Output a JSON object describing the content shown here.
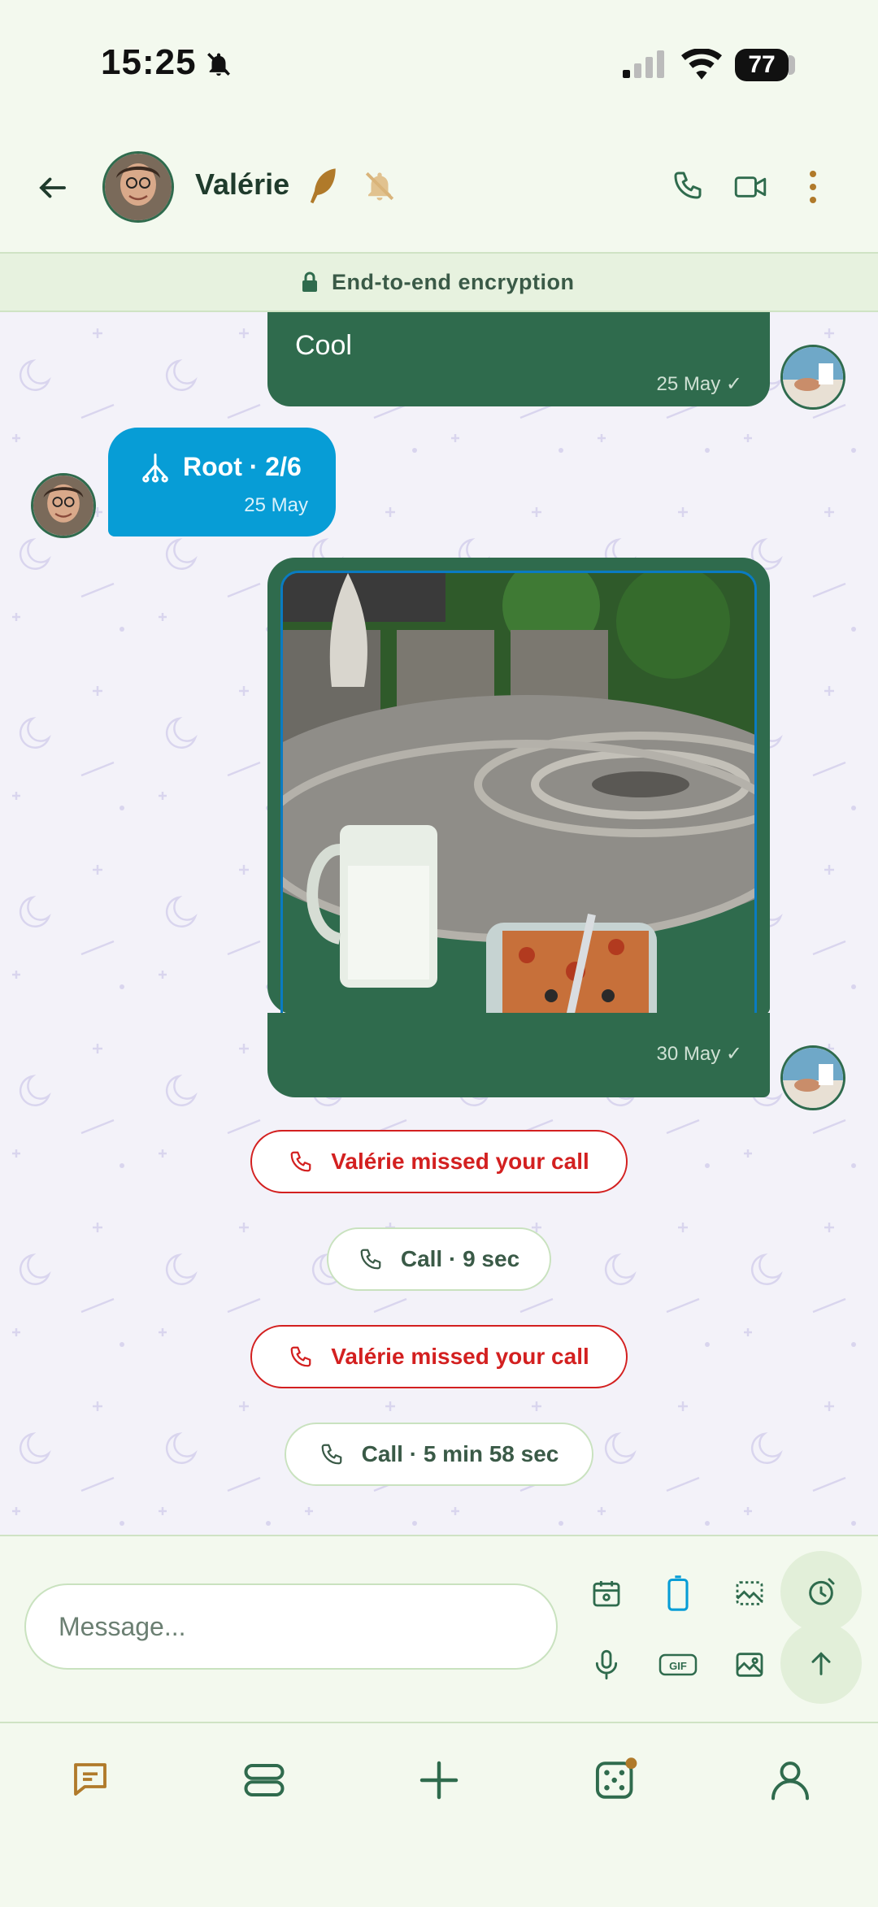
{
  "status_bar": {
    "time": "15:25",
    "battery": "77"
  },
  "header": {
    "contact_name": "Valérie"
  },
  "banner": {
    "text": "End-to-end encryption"
  },
  "messages": {
    "m1": {
      "text": "Cool",
      "time": "25 May ✓"
    },
    "m2": {
      "text": "Root · 2/6",
      "time": "25 May"
    },
    "m3": {
      "time": "30 May ✓"
    }
  },
  "calls": [
    {
      "label": "Valérie missed your call"
    },
    {
      "label": "Call · 9 sec"
    },
    {
      "label": "Valérie missed your call"
    },
    {
      "label": "Call · 5 min 58 sec"
    }
  ],
  "composer": {
    "placeholder": "Message..."
  },
  "colors": {
    "accent": "#2f6b4d",
    "incoming": "#079dd6",
    "missed": "#d32020",
    "nav_active": "#b07a2a"
  }
}
